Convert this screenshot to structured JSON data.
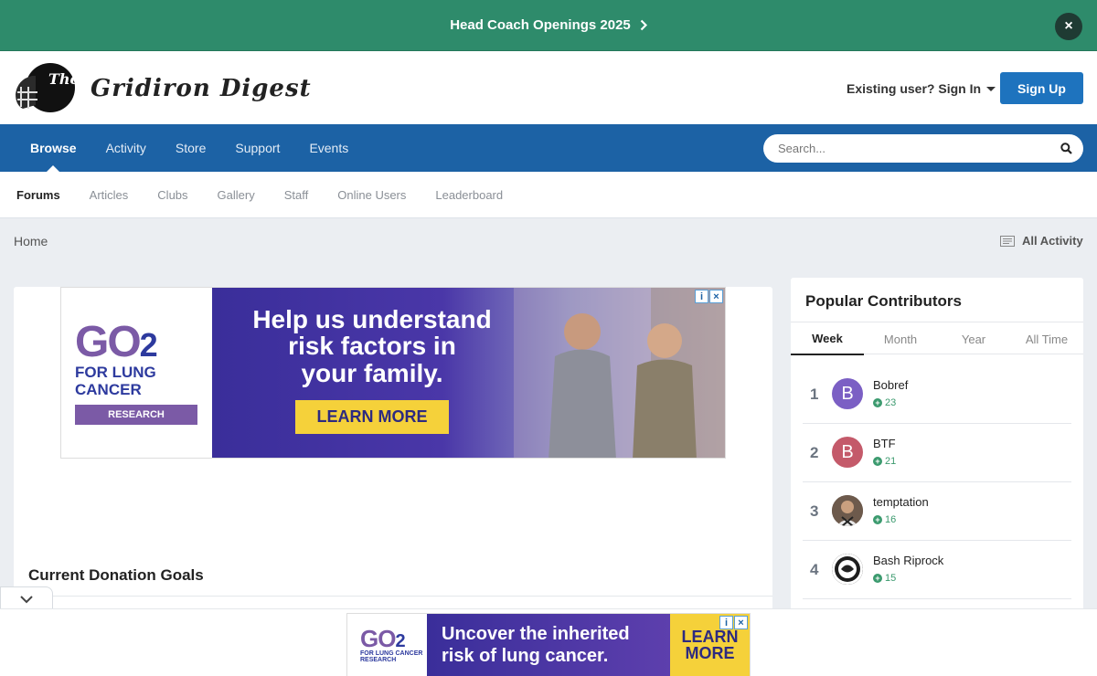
{
  "announcement": {
    "text": "Head Coach Openings 2025",
    "close": "×"
  },
  "header": {
    "site_name": "Gridiron Digest",
    "signin_label": "Existing user? Sign In",
    "signup_label": "Sign Up"
  },
  "primary_nav": {
    "items": [
      "Browse",
      "Activity",
      "Store",
      "Support",
      "Events"
    ],
    "active": "Browse",
    "search_placeholder": "Search..."
  },
  "secondary_nav": {
    "items": [
      "Forums",
      "Articles",
      "Clubs",
      "Gallery",
      "Staff",
      "Online Users",
      "Leaderboard"
    ],
    "active": "Forums"
  },
  "breadcrumb": {
    "home": "Home",
    "all_activity": "All Activity"
  },
  "ad_top": {
    "logo_text": "GO",
    "logo_sub": "2",
    "logo_line1": "FOR LUNG",
    "logo_line2": "CANCER",
    "logo_badge": "RESEARCH",
    "headline_1": "Help us understand",
    "headline_2": "risk factors in",
    "headline_3": "your family.",
    "cta": "LEARN MORE"
  },
  "main": {
    "donation_title": "Current Donation Goals"
  },
  "sidebar": {
    "title": "Popular Contributors",
    "tabs": [
      "Week",
      "Month",
      "Year",
      "All Time"
    ],
    "active_tab": "Week",
    "contributors": [
      {
        "rank": "1",
        "name": "Bobref",
        "initial": "B",
        "rep": "23",
        "color": "#7b5fc4"
      },
      {
        "rank": "2",
        "name": "BTF",
        "initial": "B",
        "rep": "21",
        "color": "#c45a6a"
      },
      {
        "rank": "3",
        "name": "temptation",
        "initial": "",
        "rep": "16",
        "color": "#5b4a3f"
      },
      {
        "rank": "4",
        "name": "Bash Riprock",
        "initial": "",
        "rep": "15",
        "color": "#2a2a2a"
      }
    ]
  },
  "ad_bottom": {
    "logo_text": "GO",
    "logo_sub": "2",
    "logo_line": "FOR LUNG CANCER RESEARCH",
    "headline_1": "Uncover the inherited",
    "headline_2": "risk of lung cancer.",
    "cta_1": "LEARN",
    "cta_2": "MORE"
  },
  "colors": {
    "announcement_bg": "#2e8b6b",
    "nav_bg": "#1c62a5",
    "signup_bg": "#1e73be",
    "rep_green": "#3b9a6e"
  }
}
